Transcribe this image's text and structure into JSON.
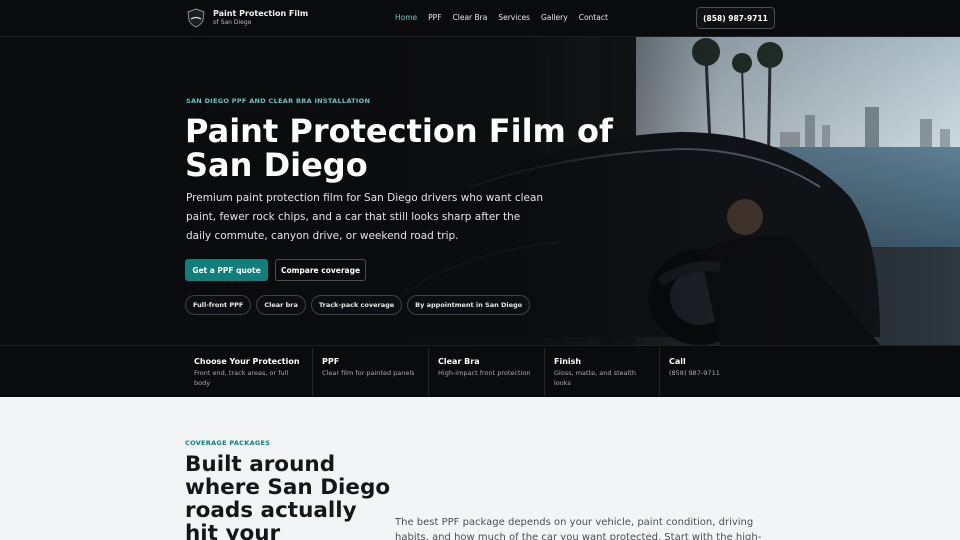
{
  "nav": {
    "brand_title": "Paint Protection Film",
    "brand_sub": "of San Diego",
    "items": [
      {
        "label": "Home",
        "active": true
      },
      {
        "label": "PPF"
      },
      {
        "label": "Clear Bra"
      },
      {
        "label": "Services"
      },
      {
        "label": "Gallery"
      },
      {
        "label": "Contact"
      }
    ],
    "phone": "(858) 987-9711"
  },
  "hero": {
    "eyebrow": "SAN DIEGO PPF AND CLEAR BRA INSTALLATION",
    "title": "Paint Protection Film of San Diego",
    "lead": "Premium paint protection film for San Diego drivers who want clean paint, fewer rock chips, and a car that still looks sharp after the daily commute, canyon drive, or weekend road trip.",
    "cta_primary": "Get a PPF quote",
    "cta_secondary": "Compare coverage",
    "pills": [
      "Full-front PPF",
      "Clear bra",
      "Track-pack coverage",
      "By appointment in San Diego"
    ]
  },
  "strip": [
    {
      "title": "Choose Your Protection",
      "sub": "Front end, track areas, or full body"
    },
    {
      "title": "PPF",
      "sub": "Clear film for painted panels"
    },
    {
      "title": "Clear Bra",
      "sub": "High-impact front protection"
    },
    {
      "title": "Finish",
      "sub": "Gloss, matte, and stealth looks"
    },
    {
      "title": "Call",
      "sub": "(858) 987-9711"
    }
  ],
  "coverage": {
    "kicker": "COVERAGE PACKAGES",
    "title": "Built around where San Diego roads actually hit your",
    "body": "The best PPF package depends on your vehicle, paint condition, driving habits, and how much of the car you want protected. Start with the high-impact zones,"
  },
  "colors": {
    "accent": "#62c4c0",
    "primary": "#0e7f7b",
    "dark": "#0a0b0d"
  }
}
